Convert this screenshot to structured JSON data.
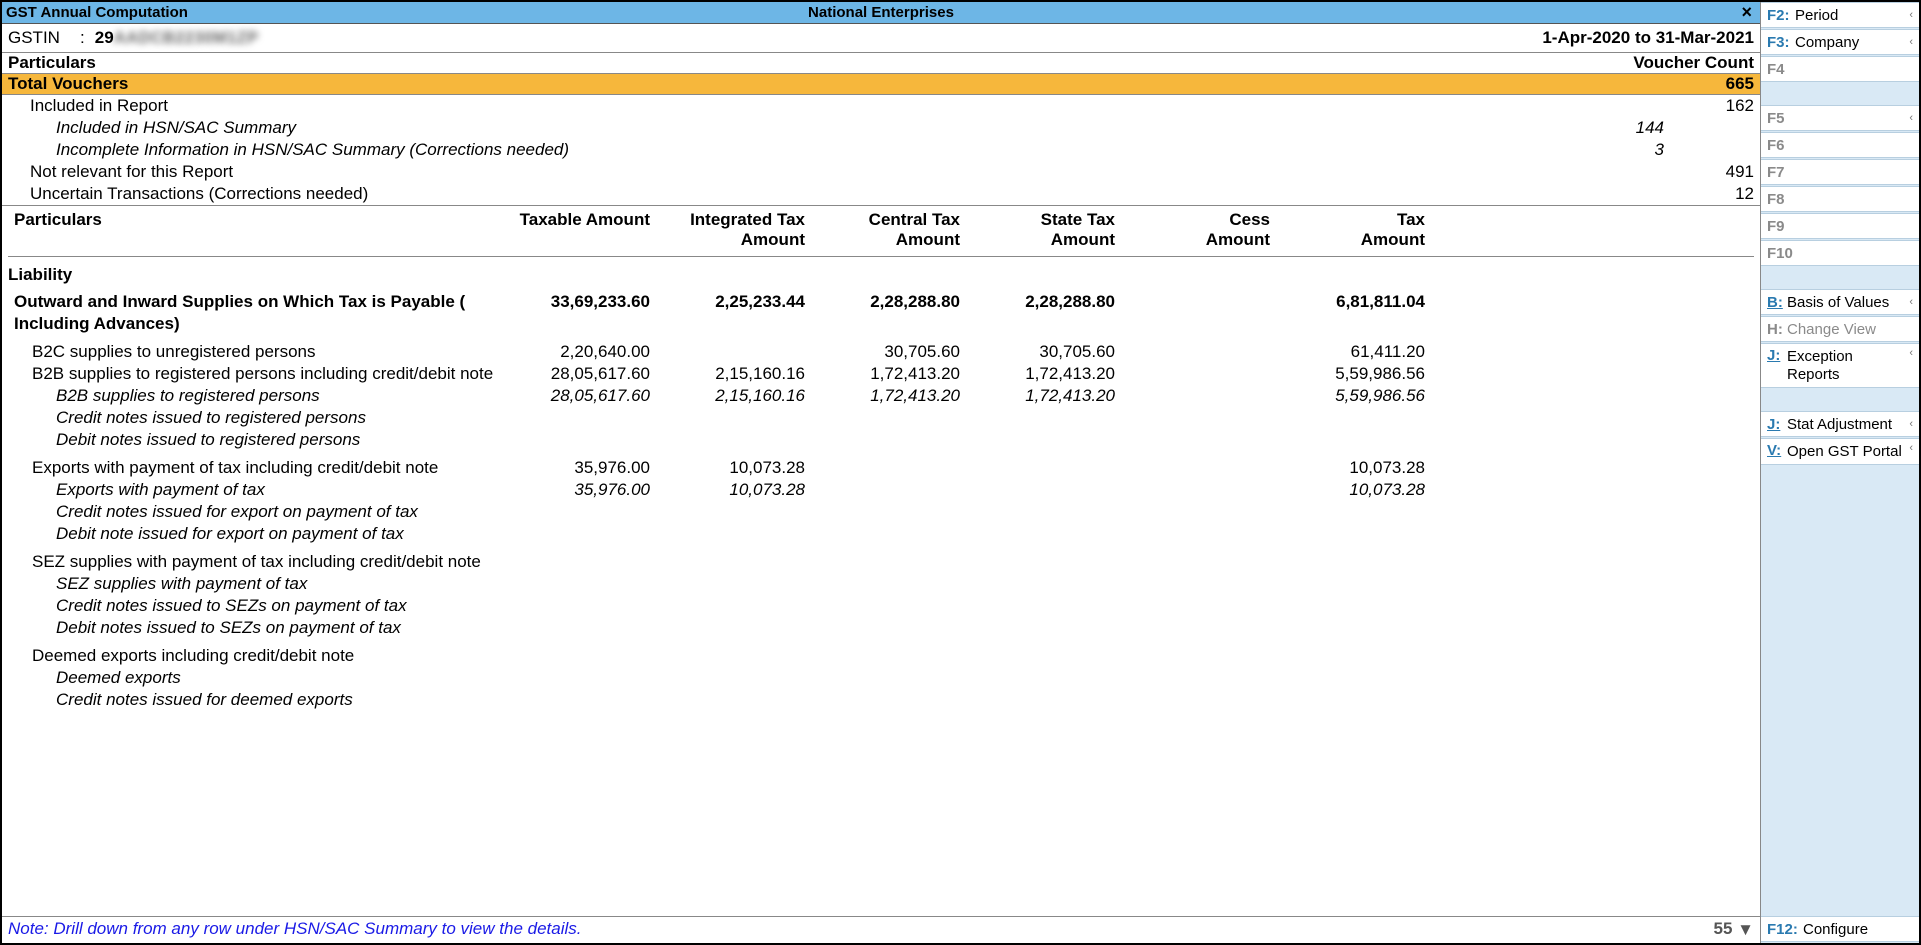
{
  "titlebar": {
    "left": "GST Annual Computation",
    "center": "National Enterprises",
    "close": "×"
  },
  "info": {
    "gstin_label": "GSTIN",
    "colon": ":",
    "gstin_prefix": "29",
    "gstin_masked": "AADCB2230M1ZP",
    "period": "1-Apr-2020 to 31-Mar-2021"
  },
  "summary_header": {
    "left": "Particulars",
    "right": "Voucher Count"
  },
  "total": {
    "label": "Total Vouchers",
    "count": "665"
  },
  "summary": [
    {
      "label": "Included in Report",
      "indent": 1,
      "mid": "",
      "count": "162",
      "ital": false
    },
    {
      "label": "Included in HSN/SAC Summary",
      "indent": 2,
      "mid": "144",
      "count": "",
      "ital": true
    },
    {
      "label": "Incomplete Information in HSN/SAC Summary (Corrections needed)",
      "indent": 2,
      "mid": "3",
      "count": "",
      "ital": true
    },
    {
      "label": "Not relevant for this Report",
      "indent": 1,
      "mid": "",
      "count": "491",
      "ital": false
    },
    {
      "label": "Uncertain Transactions (Corrections needed)",
      "indent": 1,
      "mid": "",
      "count": "12",
      "ital": false
    }
  ],
  "columns": {
    "c0": "Particulars",
    "c1a": "Taxable Amount",
    "c1b": "",
    "c2a": "Integrated Tax",
    "c2b": "Amount",
    "c3a": "Central Tax",
    "c3b": "Amount",
    "c4a": "State Tax",
    "c4b": "Amount",
    "c5a": "Cess",
    "c5b": "Amount",
    "c6a": "Tax",
    "c6b": "Amount"
  },
  "sections": {
    "liability": "Liability",
    "outward_l1": "Outward and Inward Supplies on Which Tax is Payable (",
    "outward_l2": "Including Advances)"
  },
  "rows": {
    "outward_totals": {
      "c1": "33,69,233.60",
      "c2": "2,25,233.44",
      "c3": "2,28,288.80",
      "c4": "2,28,288.80",
      "c5": "",
      "c6": "6,81,811.04"
    },
    "b2c": {
      "label": "B2C supplies to unregistered persons",
      "c1": "2,20,640.00",
      "c2": "",
      "c3": "30,705.60",
      "c4": "30,705.60",
      "c5": "",
      "c6": "61,411.20"
    },
    "b2b": {
      "label": "B2B supplies to registered persons including credit/debit note",
      "c1": "28,05,617.60",
      "c2": "2,15,160.16",
      "c3": "1,72,413.20",
      "c4": "1,72,413.20",
      "c5": "",
      "c6": "5,59,986.56"
    },
    "b2b_sub": {
      "label": "B2B supplies to registered persons",
      "c1": "28,05,617.60",
      "c2": "2,15,160.16",
      "c3": "1,72,413.20",
      "c4": "1,72,413.20",
      "c5": "",
      "c6": "5,59,986.56"
    },
    "b2b_cn": {
      "label": "Credit notes issued to registered persons"
    },
    "b2b_dn": {
      "label": "Debit notes issued to registered persons"
    },
    "exp": {
      "label": "Exports with payment of tax including credit/debit note",
      "c1": "35,976.00",
      "c2": "10,073.28",
      "c3": "",
      "c4": "",
      "c5": "",
      "c6": "10,073.28"
    },
    "exp_sub": {
      "label": "Exports with payment of tax",
      "c1": "35,976.00",
      "c2": "10,073.28",
      "c3": "",
      "c4": "",
      "c5": "",
      "c6": "10,073.28"
    },
    "exp_cn": {
      "label": "Credit notes issued for export on payment of tax"
    },
    "exp_dn": {
      "label": "Debit note issued for export on payment of tax"
    },
    "sez": {
      "label": "SEZ supplies with payment of tax including credit/debit note"
    },
    "sez_sub": {
      "label": "SEZ supplies with payment of tax"
    },
    "sez_cn": {
      "label": "Credit notes issued to SEZs on payment of tax"
    },
    "sez_dn": {
      "label": "Debit notes issued to SEZs on payment of tax"
    },
    "deemed": {
      "label": "Deemed exports including credit/debit note"
    },
    "deemed_sub": {
      "label": "Deemed exports"
    },
    "deemed_cn": {
      "label": "Credit notes issued for deemed exports"
    }
  },
  "footer": {
    "note": "Note: Drill down from any row under HSN/SAC Summary to view the details.",
    "page": "55",
    "arrow": "▼"
  },
  "sidebar": {
    "f2": {
      "key": "F2:",
      "label": "Period"
    },
    "f3": {
      "key": "F3:",
      "label": "Company"
    },
    "f4": {
      "key": "F4",
      "label": ""
    },
    "f5": {
      "key": "F5",
      "label": ""
    },
    "f6": {
      "key": "F6",
      "label": ""
    },
    "f7": {
      "key": "F7",
      "label": ""
    },
    "f8": {
      "key": "F8",
      "label": ""
    },
    "f9": {
      "key": "F9",
      "label": ""
    },
    "f10": {
      "key": "F10",
      "label": ""
    },
    "b": {
      "key": "B:",
      "label": "Basis of Values"
    },
    "h": {
      "key": "H:",
      "label": "Change View"
    },
    "j1": {
      "key": "J:",
      "label": "Exception Reports"
    },
    "j2": {
      "key": "J:",
      "label": "Stat Adjustment"
    },
    "v": {
      "key": "V:",
      "label": "Open GST Portal"
    },
    "f12": {
      "key": "F12:",
      "label": "Configure"
    }
  }
}
